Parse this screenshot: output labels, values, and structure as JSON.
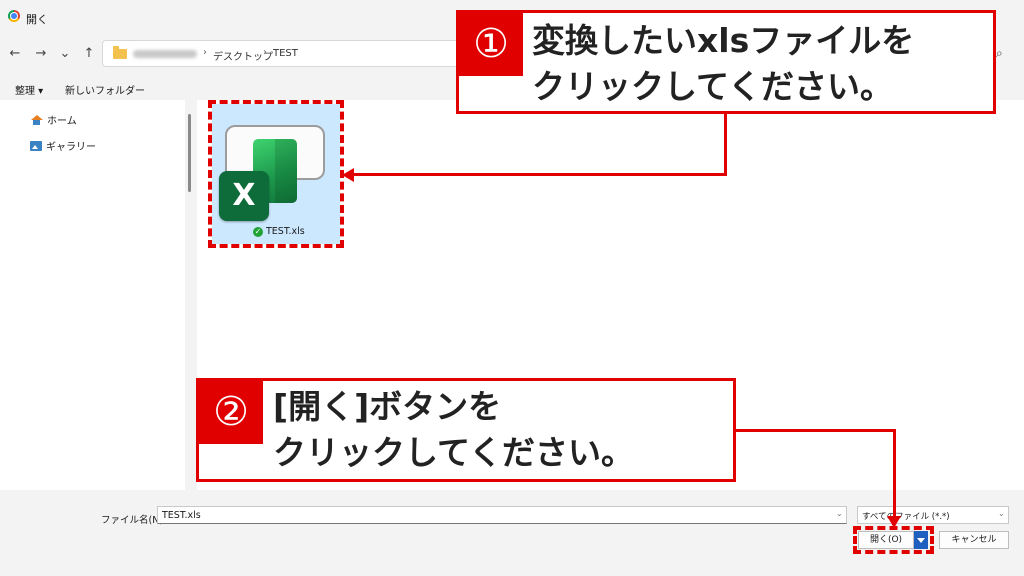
{
  "window": {
    "title": "開く"
  },
  "nav": {
    "back": "←",
    "forward": "→",
    "recent": "⌄",
    "up": "↑"
  },
  "breadcrumb": {
    "sep1": "›",
    "folder": "デスクトップ",
    "sep2": "›",
    "current": "TEST"
  },
  "commandbar": {
    "organize": "整理 ▾",
    "new_folder": "新しいフォルダー"
  },
  "sidebar": {
    "items": [
      {
        "label": "ホーム",
        "icon": "home-icon"
      },
      {
        "label": "ギャラリー",
        "icon": "gallery-icon"
      }
    ]
  },
  "file": {
    "name": "TEST.xls",
    "badge": "X",
    "status_check": "✓"
  },
  "bottom": {
    "filename_label": "ファイル名(N):",
    "filename_value": "TEST.xls",
    "filter_value": "すべてのファイル (*.*)",
    "open_label": "開く(O)",
    "cancel_label": "キャンセル",
    "dropdown": "⌄"
  },
  "annotations": {
    "step1_badge": "①",
    "step1_line1": "変換したいxlsファイルを",
    "step1_line2": "クリックしてください。",
    "step2_badge": "②",
    "step2_line1": "[開く]ボタンを",
    "step2_line2": "クリックしてください。",
    "accent_color": "#e00000"
  }
}
